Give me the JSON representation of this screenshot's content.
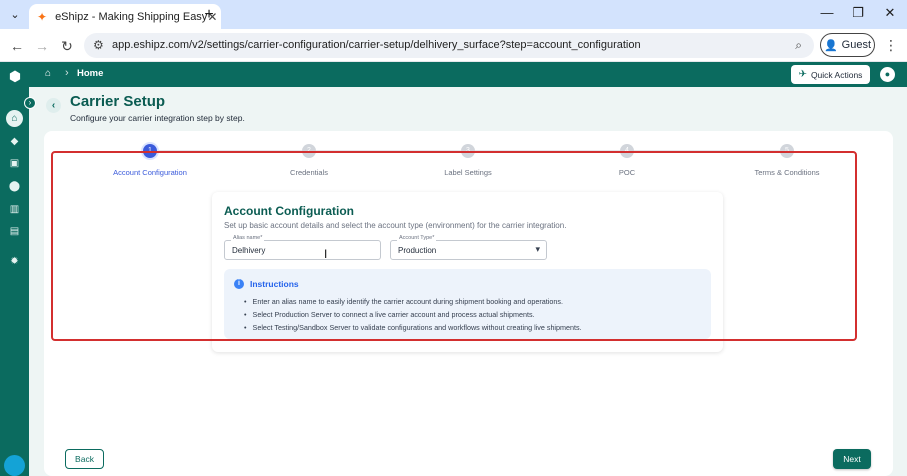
{
  "browser": {
    "tab_title": "eShipz - Making Shipping Easy",
    "url": "app.eshipz.com/v2/settings/carrier-configuration/carrier-setup/delhivery_surface?step=account_configuration",
    "profile_label": "Guest"
  },
  "header": {
    "breadcrumb": "Home",
    "quick_actions_label": "Quick Actions"
  },
  "page": {
    "title": "Carrier Setup",
    "subtitle": "Configure your carrier integration step by step."
  },
  "steps": [
    {
      "number": "1",
      "label": "Account Configuration",
      "active": true
    },
    {
      "number": "2",
      "label": "Credentials",
      "active": false
    },
    {
      "number": "3",
      "label": "Label Settings",
      "active": false
    },
    {
      "number": "4",
      "label": "POC",
      "active": false
    },
    {
      "number": "5",
      "label": "Terms & Conditions",
      "active": false
    }
  ],
  "form": {
    "title": "Account Configuration",
    "subtitle": "Set up basic account details and select the account type (environment) for the carrier integration.",
    "alias_label": "Alias name*",
    "alias_value": "Delhivery",
    "account_type_label": "Account Type*",
    "account_type_value": "Production"
  },
  "instructions": {
    "title": "Instructions",
    "items": [
      "Enter an alias name to easily identify the carrier account during shipment booking and operations.",
      "Select Production Server to connect a live carrier account and process actual shipments.",
      "Select Testing/Sandbox Server to validate configurations and workflows without creating live shipments."
    ]
  },
  "actions": {
    "back_label": "Back",
    "next_label": "Next"
  },
  "colors": {
    "brand": "#0b6b5f",
    "active_step": "#3b5bdb",
    "highlight": "#d32f2f"
  }
}
